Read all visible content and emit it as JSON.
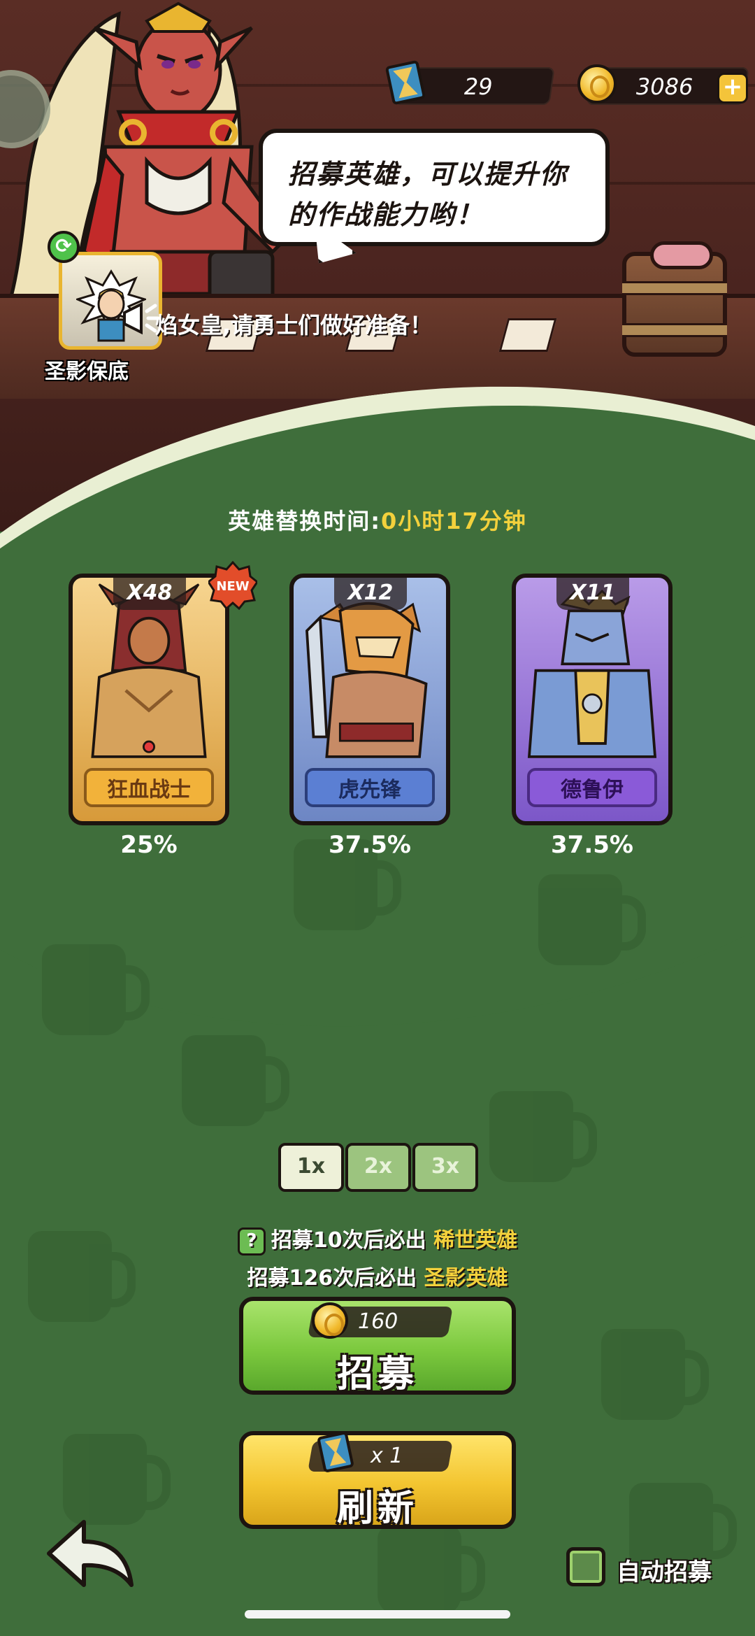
{
  "resources": {
    "hourglass_count": "29",
    "coins": "3086"
  },
  "speech_bubble": "招募英雄，可以提升你\n的作战能力哟！",
  "guarantee_badge": {
    "label": "圣影保底"
  },
  "marquee": "焰女皇,请勇士们做好准备！",
  "timer": {
    "label": "英雄替换时间:",
    "value": "0小时17分钟"
  },
  "heroes": [
    {
      "count": "X48",
      "name": "狂血战士",
      "rate": "25%",
      "is_new": true,
      "new_label": "NEW",
      "color": "#f2b23a"
    },
    {
      "count": "X12",
      "name": "虎先锋",
      "rate": "37.5%",
      "is_new": false,
      "color": "#5b7fd3"
    },
    {
      "count": "X11",
      "name": "德鲁伊",
      "rate": "37.5%",
      "is_new": false,
      "color": "#8a5ad8"
    }
  ],
  "multipliers": [
    {
      "label": "1x",
      "active": true
    },
    {
      "label": "2x",
      "active": false
    },
    {
      "label": "3x",
      "active": false
    }
  ],
  "info": {
    "line1_prefix": "招募10次后必出",
    "line1_highlight": "稀世英雄",
    "line1_icon": "?",
    "line2_prefix": "招募126次后必出",
    "line2_highlight": "圣影英雄"
  },
  "recruit_button": {
    "cost": "160",
    "label": "招募"
  },
  "refresh_button": {
    "cost": "x 1",
    "label": "刷新"
  },
  "auto_recruit": {
    "label": "自动招募",
    "checked": false
  }
}
